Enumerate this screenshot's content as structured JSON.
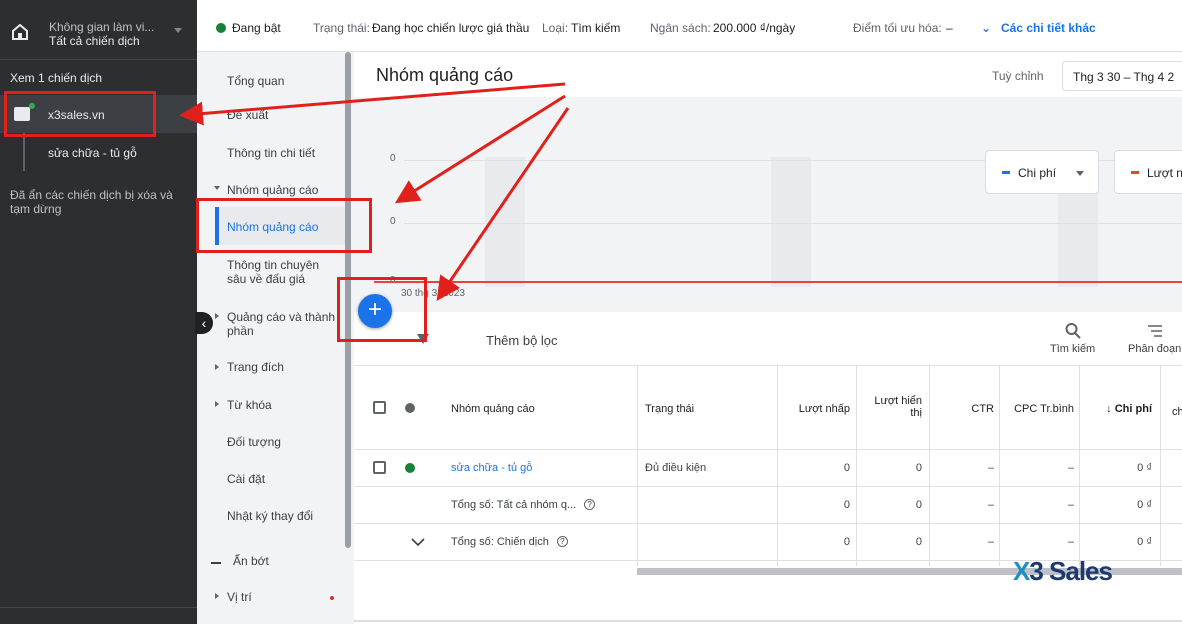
{
  "workspace": {
    "line1": "Không gian làm vi...",
    "line2": "Tất cả chiến dịch",
    "icon": "home-icon"
  },
  "left": {
    "view_label": "Xem 1 chiến dịch",
    "campaign": "x3sales.vn",
    "ad_group": "sửa chữa - tủ gỗ",
    "hidden_note": "Đã ẩn các chiến dịch bị xóa và tạm dừng"
  },
  "nav": {
    "items": [
      "Tổng quan",
      "Đề xuất",
      "Thông tin chi tiết",
      "Nhóm quảng cáo",
      "Nhóm quảng cáo",
      "Thông tin chuyên sâu về đấu giá",
      "Quảng cáo và thành phần",
      "Trang đích",
      "Từ khóa",
      "Đối tượng",
      "Cài đặt",
      "Nhật ký thay đổi",
      "Ẩn bớt",
      "Vị trí"
    ]
  },
  "topbar": {
    "status": "Đang bật",
    "state_label": "Trạng thái:",
    "state_value": "Đang học chiến lược giá thầu",
    "type_label": "Loại:",
    "type_value": "Tìm kiếm",
    "budget_label": "Ngân sách:",
    "budget_value": "200.000 ₫/ngày",
    "opt_label": "Điểm tối ưu hóa:",
    "opt_value": "–",
    "more": "Các chi tiết khác"
  },
  "main": {
    "title": "Nhóm quảng cáo",
    "customize": "Tuỳ chỉnh",
    "date_range": "Thg 3 30 – Thg 4 2"
  },
  "chart": {
    "metrics": [
      {
        "label": "Chi phí",
        "color": "#1a73e8"
      },
      {
        "label": "Lượt n",
        "color": "#ea4335"
      }
    ],
    "y_ticks": [
      "0",
      "0",
      "0"
    ],
    "x_label": "30 thg 3, 2023"
  },
  "filter": {
    "label": "Thêm bộ lọc",
    "search": "Tìm kiếm",
    "segment": "Phân đoạn"
  },
  "table": {
    "headers": [
      "Nhóm quảng cáo",
      "Trạng thái",
      "Lượt nhấp",
      "Lượt hiển thị",
      "CTR",
      "CPC Tr.bình",
      "↓ Chi phí",
      "ch"
    ],
    "rows": [
      {
        "name": "sửa chữa - tủ gỗ",
        "status": "Đủ điều kiện",
        "clicks": "0",
        "impr": "0",
        "ctr": "–",
        "cpc": "–",
        "cost": "0 ₫"
      },
      {
        "name": "Tổng số: Tất cả nhóm q...",
        "status": "",
        "clicks": "0",
        "impr": "0",
        "ctr": "–",
        "cpc": "–",
        "cost": "0 ₫"
      },
      {
        "name": "Tổng số: Chiến dịch",
        "status": "",
        "clicks": "0",
        "impr": "0",
        "ctr": "–",
        "cpc": "–",
        "cost": "0 ₫"
      }
    ]
  },
  "brand": {
    "x": "X",
    "rest": "3 Sales"
  }
}
